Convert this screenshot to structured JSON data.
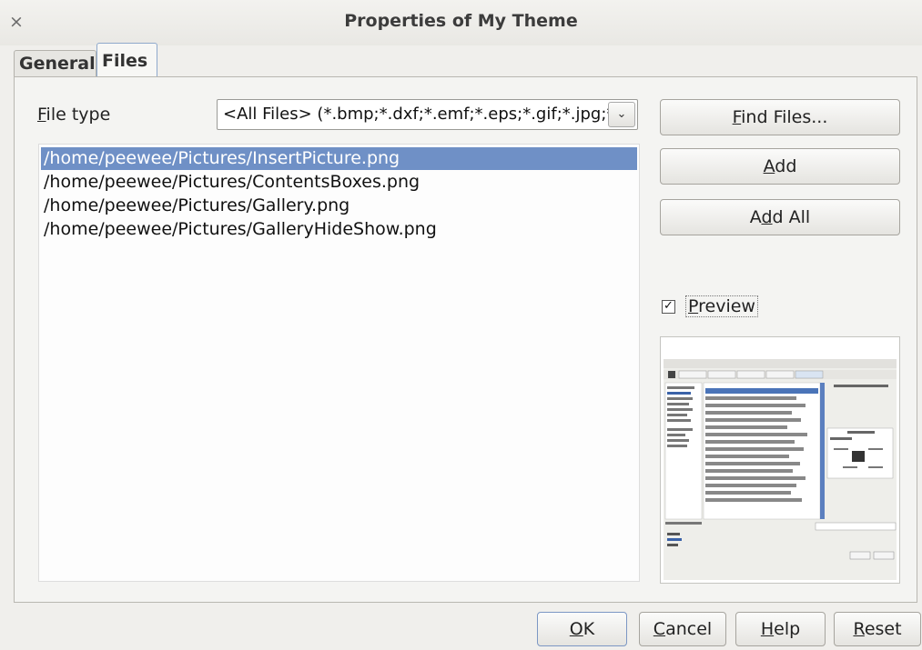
{
  "window": {
    "title": "Properties of My Theme",
    "close_glyph": "×"
  },
  "tabs": [
    {
      "label": "General",
      "active": false
    },
    {
      "label": "Files",
      "active": true
    }
  ],
  "file_type": {
    "label_underlined": "F",
    "label_rest": "ile type",
    "value": "<All Files> (*.bmp;*.dxf;*.emf;*.eps;*.gif;*.jpg;*.png)",
    "arrow_glyph": "⌄"
  },
  "files": [
    {
      "path": "/home/peewee/Pictures/InsertPicture.png",
      "selected": true
    },
    {
      "path": "/home/peewee/Pictures/ContentsBoxes.png",
      "selected": false
    },
    {
      "path": "/home/peewee/Pictures/Gallery.png",
      "selected": false
    },
    {
      "path": "/home/peewee/Pictures/GalleryHideShow.png",
      "selected": false
    }
  ],
  "side_buttons": {
    "find": {
      "underlined": "F",
      "rest": "ind Files..."
    },
    "add": {
      "underlined": "A",
      "rest": "dd"
    },
    "add_all": {
      "pre": "A",
      "underlined": "d",
      "rest": "d All"
    }
  },
  "preview": {
    "checked": true,
    "check_glyph": "✓",
    "label_underlined": "P",
    "label_rest": "review"
  },
  "bottom_buttons": {
    "ok": {
      "underlined": "O",
      "rest": "K"
    },
    "cancel": {
      "underlined": "C",
      "rest": "ancel"
    },
    "help": {
      "underlined": "H",
      "rest": "elp"
    },
    "reset": {
      "underlined": "R",
      "rest": "eset"
    }
  },
  "colors": {
    "selection": "#6f90c6",
    "accent_border": "#7c97c4"
  }
}
